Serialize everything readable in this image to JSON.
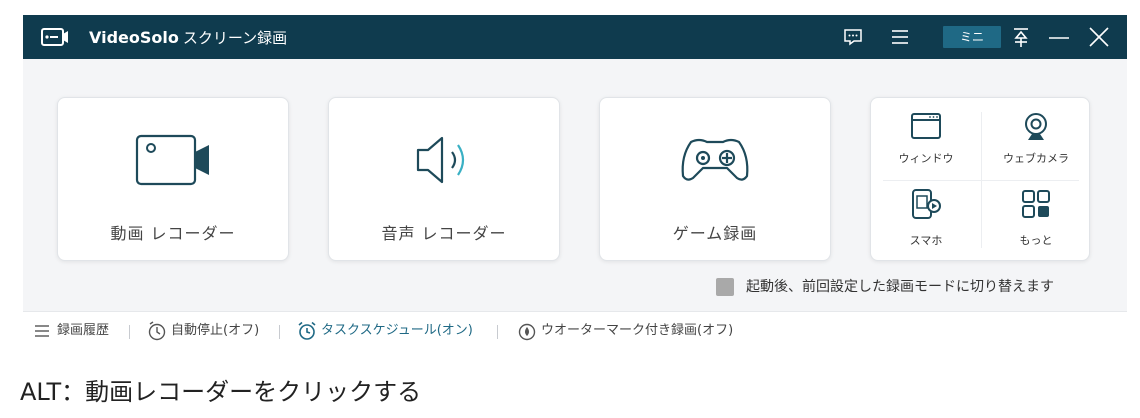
{
  "titlebar": {
    "brand": "VideoSolo",
    "title_rest": "スクリーン録画",
    "mini_label": "ミニ",
    "icons": [
      "feedback-icon",
      "menu-icon",
      "pin-icon",
      "minimize-icon",
      "close-icon"
    ]
  },
  "cards": {
    "video_label": "動画 レコーダー",
    "audio_label": "音声 レコーダー",
    "game_label": "ゲーム録画"
  },
  "multi": {
    "window_label": "ウィンドウ",
    "webcam_label": "ウェブカメラ",
    "phone_label": "スマホ",
    "more_label": "もっと"
  },
  "remember": {
    "text": "起動後、前回設定した録画モードに切り替えます"
  },
  "bottombar": {
    "history": "録画履歴",
    "autostop": "自動停止(オフ)",
    "schedule": "タスクスケジュール(オン)",
    "watermark": "ウオーターマーク付き録画(オフ)"
  },
  "caption": {
    "text": "ALT：動画レコーダーをクリックする"
  },
  "colors": {
    "titlebar": "#0f3b4e",
    "accent": "#1f6985",
    "icon_stroke": "#1e4a5a"
  }
}
